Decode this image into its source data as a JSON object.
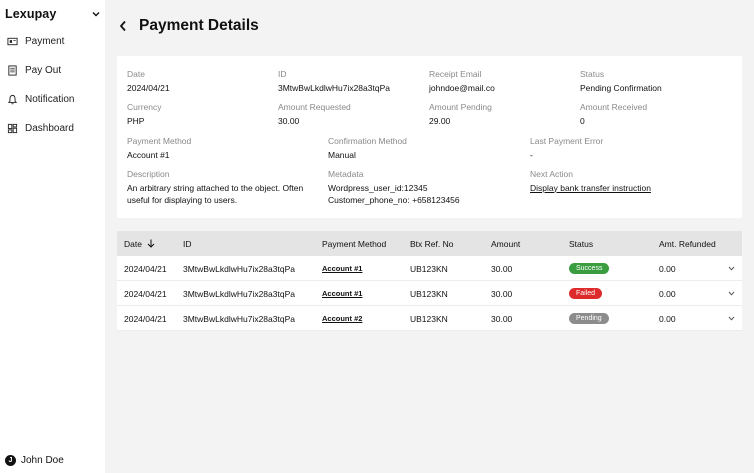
{
  "sidebar": {
    "brand": "Lexupay",
    "items": [
      {
        "label": "Payment",
        "icon": "payment-icon"
      },
      {
        "label": "Pay Out",
        "icon": "payout-icon"
      },
      {
        "label": "Notification",
        "icon": "bell-icon"
      },
      {
        "label": "Dashboard",
        "icon": "dashboard-icon"
      }
    ],
    "user": {
      "initial": "J",
      "name": "John Doe"
    }
  },
  "header": {
    "title": "Payment Details"
  },
  "details": {
    "date": {
      "label": "Date",
      "value": "2024/04/21"
    },
    "id": {
      "label": "ID",
      "value": "3MtwBwLkdlwHu7ix28a3tqPa"
    },
    "receipt_email": {
      "label": "Receipt Email",
      "value": "johndoe@mail.co"
    },
    "status": {
      "label": "Status",
      "value": "Pending Confirmation"
    },
    "currency": {
      "label": "Currency",
      "value": "PHP"
    },
    "amount_requested": {
      "label": "Amount Requested",
      "value": "30.00"
    },
    "amount_pending": {
      "label": "Amount Pending",
      "value": "29.00"
    },
    "amount_received": {
      "label": "Amount Received",
      "value": "0"
    },
    "payment_method": {
      "label": "Payment Method",
      "value": "Account #1"
    },
    "confirmation_method": {
      "label": "Confirmation Method",
      "value": "Manual"
    },
    "last_payment_error": {
      "label": "Last Payment Error",
      "value": "-"
    },
    "description": {
      "label": "Description",
      "line1": "An arbitrary string attached to the object. Often",
      "line2": "useful for displaying to users."
    },
    "metadata": {
      "label": "Metadata",
      "line1": "Wordpress_user_id:12345",
      "line2": "Customer_phone_no: +658123456"
    },
    "next_action": {
      "label": "Next Action",
      "value": "Display bank transfer instruction"
    }
  },
  "table": {
    "headers": {
      "date": "Date",
      "id": "ID",
      "method": "Payment Method",
      "btx": "Btx Ref. No",
      "amount": "Amount",
      "status": "Status",
      "refunded": "Amt. Refunded"
    },
    "rows": [
      {
        "date": "2024/04/21",
        "id": "3MtwBwLkdlwHu7ix28a3tqPa",
        "method": "Account #1",
        "btx": "UB123KN",
        "amount": "30.00",
        "status": "Success",
        "refunded": "0.00"
      },
      {
        "date": "2024/04/21",
        "id": "3MtwBwLkdlwHu7ix28a3tqPa",
        "method": "Account #1",
        "btx": "UB123KN",
        "amount": "30.00",
        "status": "Failed",
        "refunded": "0.00"
      },
      {
        "date": "2024/04/21",
        "id": "3MtwBwLkdlwHu7ix28a3tqPa",
        "method": "Account #2",
        "btx": "UB123KN",
        "amount": "30.00",
        "status": "Pending",
        "refunded": "0.00"
      }
    ]
  },
  "colors": {
    "success": "#3a9d3f",
    "failed": "#dd2b2b",
    "pending": "#8c8c8c",
    "background": "#f3f3f3"
  }
}
